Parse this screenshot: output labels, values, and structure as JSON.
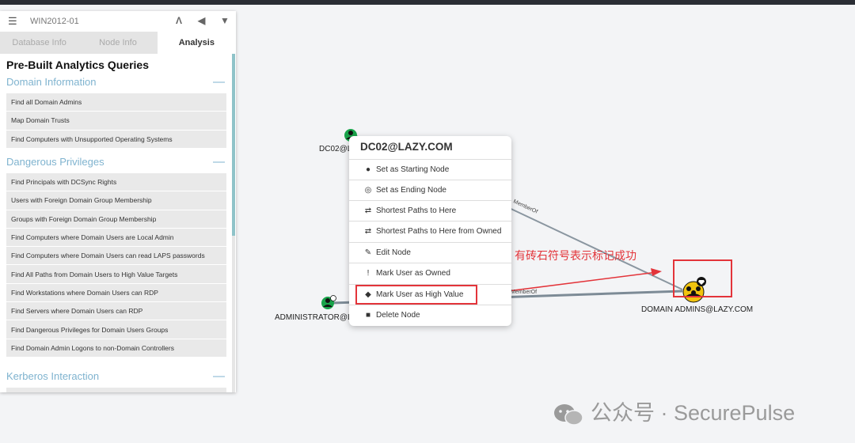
{
  "panel": {
    "host": "WIN2012-01",
    "tabs": [
      "Database Info",
      "Node Info",
      "Analysis"
    ],
    "heading": "Pre-Built Analytics Queries",
    "sections": [
      {
        "title": "Domain Information",
        "toggle": "—"
      },
      {
        "title": "Dangerous Privileges",
        "toggle": "—"
      },
      {
        "title": "Kerberos Interaction",
        "toggle": "—"
      }
    ],
    "domain_queries": [
      "Find all Domain Admins",
      "Map Domain Trusts",
      "Find Computers with Unsupported Operating Systems"
    ],
    "privilege_queries": [
      "Find Principals with DCSync Rights",
      "Users with Foreign Domain Group Membership",
      "Groups with Foreign Domain Group Membership",
      "Find Computers where Domain Users are Local Admin",
      "Find Computers where Domain Users can read LAPS passwords",
      "Find All Paths from Domain Users to High Value Targets",
      "Find Workstations where Domain Users can RDP",
      "Find Servers where Domain Users can RDP",
      "Find Dangerous Privileges for Domain Users Groups",
      "Find Domain Admin Logons to non-Domain Controllers"
    ]
  },
  "graph": {
    "nodes": {
      "dc02": "DC02@L",
      "admin": "ADMINISTRATOR@LA",
      "domain_admins": "DOMAIN ADMINS@LAZY.COM"
    },
    "edges": [
      "MemberOf",
      "MemberOf"
    ]
  },
  "menu": {
    "title": "DC02@LAZY.COM",
    "items": [
      {
        "label": "Set as Starting Node",
        "icon": "map-marker-icon"
      },
      {
        "label": "Set as Ending Node",
        "icon": "bullseye-icon"
      },
      {
        "label": "Shortest Paths to Here",
        "icon": "shuffle-icon"
      },
      {
        "label": "Shortest Paths to Here from Owned",
        "icon": "shuffle-icon"
      },
      {
        "label": "Edit Node",
        "icon": "edit-icon"
      },
      {
        "label": "Mark User as Owned",
        "icon": "exclamation-icon"
      },
      {
        "label": "Mark User as High Value",
        "icon": "gem-icon"
      },
      {
        "label": "Delete Node",
        "icon": "trash-icon"
      }
    ]
  },
  "annotation": "有砖石符号表示标记成功",
  "watermark": "公众号 · SecurePulse",
  "colors": {
    "accent": "#7fb3cf",
    "highlight": "#e3343a",
    "node_green": "#19a34a",
    "node_yellow": "#f1c40f"
  }
}
